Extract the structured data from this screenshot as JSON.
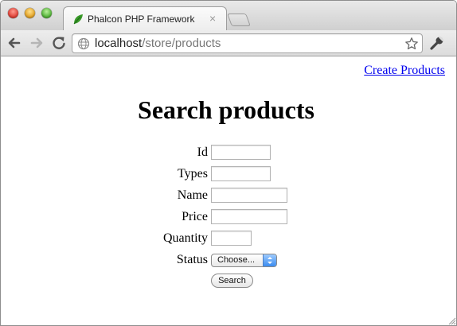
{
  "browser": {
    "tab_title": "Phalcon PHP Framework",
    "tab_close_symbol": "×",
    "url_host": "localhost",
    "url_path": "/store/products",
    "icons": {
      "back": "back-arrow-icon",
      "forward": "forward-arrow-icon",
      "reload": "reload-icon",
      "site": "globe-icon",
      "bookmark": "star-icon",
      "menu": "wrench-icon",
      "favicon": "phalcon-leaf-icon"
    }
  },
  "page": {
    "create_link": "Create Products",
    "title": "Search products",
    "form": {
      "fields": [
        {
          "label": "Id",
          "value": ""
        },
        {
          "label": "Types",
          "value": ""
        },
        {
          "label": "Name",
          "value": ""
        },
        {
          "label": "Price",
          "value": ""
        },
        {
          "label": "Quantity",
          "value": ""
        }
      ],
      "status": {
        "label": "Status",
        "selected": "Choose..."
      },
      "submit_label": "Search"
    }
  },
  "colors": {
    "link": "#0000ee",
    "favicon": "#3a9a2a",
    "select_accent": "#3a8cf0"
  }
}
